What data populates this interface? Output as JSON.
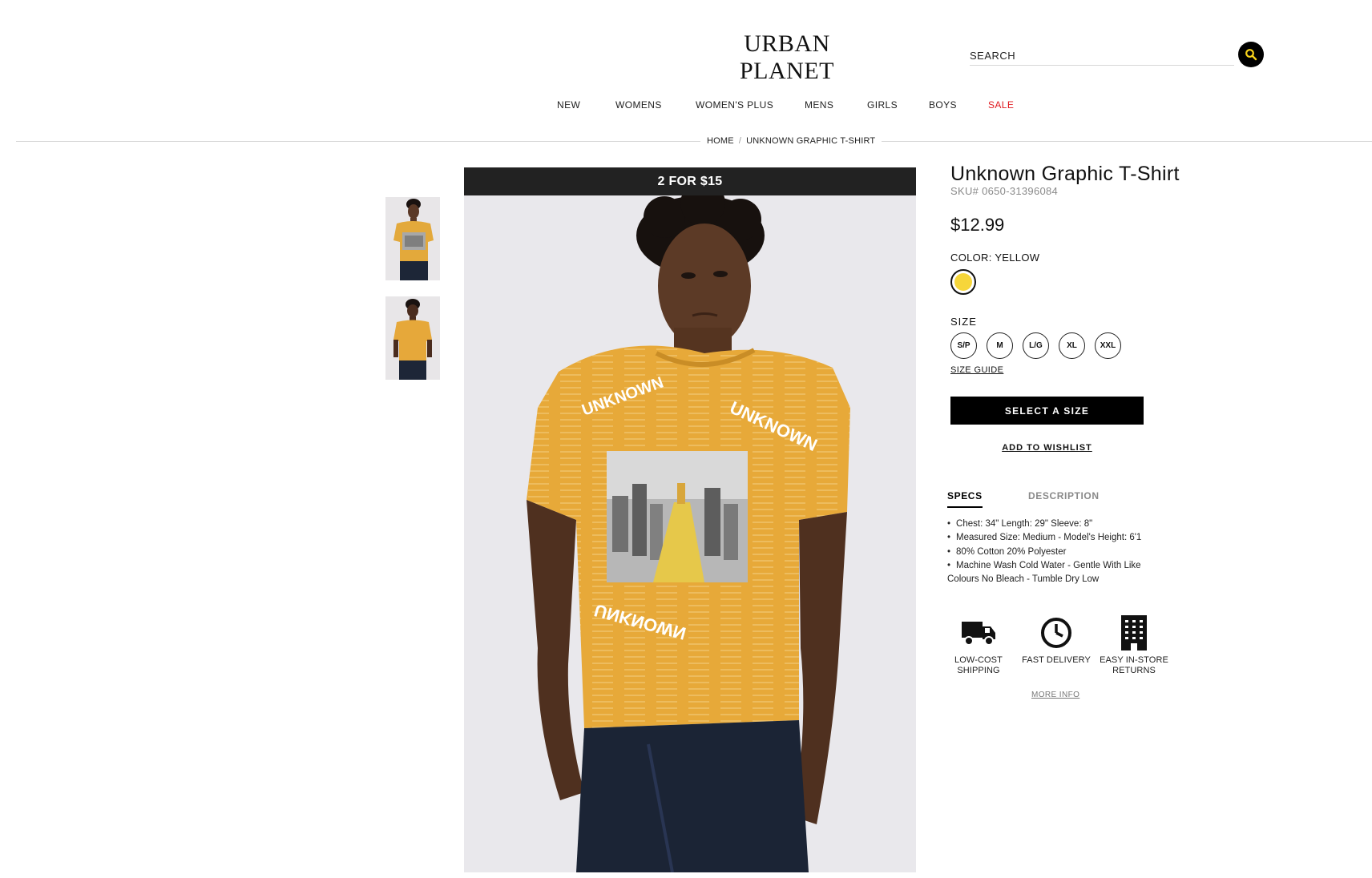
{
  "brand": {
    "logo_text": "URBAN PLANET"
  },
  "search": {
    "placeholder": "SEARCH",
    "value": ""
  },
  "nav": {
    "items": [
      {
        "label": "NEW"
      },
      {
        "label": "WOMENS"
      },
      {
        "label": "WOMEN'S PLUS"
      },
      {
        "label": "MENS"
      },
      {
        "label": "GIRLS"
      },
      {
        "label": "BOYS"
      },
      {
        "label": "SALE"
      }
    ]
  },
  "breadcrumb": {
    "items": [
      "HOME",
      "UNKNOWN GRAPHIC T-SHIRT"
    ],
    "separator": "/"
  },
  "gallery": {
    "promo_banner": "2 FOR $15",
    "thumbnails": [
      "front-view",
      "back-view"
    ]
  },
  "product": {
    "title": "Unknown Graphic T-Shirt",
    "sku": "SKU# 0650-31396084",
    "price": "$12.99",
    "color_label": "COLOR: YELLOW",
    "swatch_color": "#f6d63a",
    "size_label": "SIZE",
    "sizes": [
      "S/P",
      "M",
      "L/G",
      "XL",
      "XXL"
    ],
    "size_guide": "SIZE GUIDE",
    "select_button": "SELECT A SIZE",
    "wishlist": "ADD TO WISHLIST"
  },
  "tabs": [
    {
      "label": "SPECS",
      "active": true
    },
    {
      "label": "DESCRIPTION",
      "active": false
    }
  ],
  "specs": [
    "Chest: 34\" Length: 29\" Sleeve: 8\"",
    "Measured Size: Medium - Model's Height: 6'1",
    "80% Cotton 20% Polyester",
    "Machine Wash Cold Water - Gentle With Like Colours  No Bleach - Tumble Dry Low"
  ],
  "features": [
    {
      "icon": "truck-icon",
      "label": "LOW-COST SHIPPING"
    },
    {
      "icon": "clock-icon",
      "label": "FAST DELIVERY"
    },
    {
      "icon": "store-icon",
      "label": "EASY IN-STORE RETURNS"
    }
  ],
  "more_info": "MORE INFO",
  "colors": {
    "accent_yellow": "#f6d63a",
    "sale_red": "#e0191f",
    "search_icon_yellow": "#f7d21a"
  }
}
